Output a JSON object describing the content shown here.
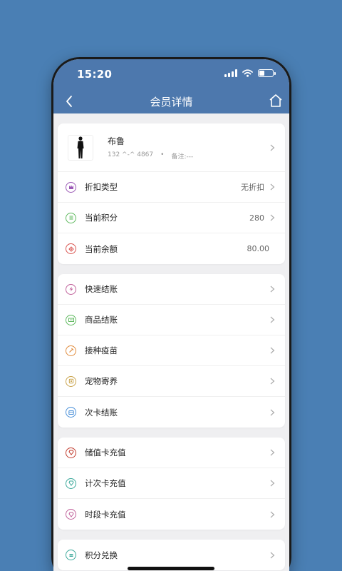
{
  "status": {
    "time": "15:20"
  },
  "nav": {
    "title": "会员详情"
  },
  "profile": {
    "name": "布鲁",
    "phone": "132 ^-^ 4867",
    "dot": "•",
    "note": "备注:---"
  },
  "info_rows": [
    {
      "label": "折扣类型",
      "value": "无折扣",
      "icon": "crown-icon",
      "color": "#9b59b6"
    },
    {
      "label": "当前积分",
      "value": "280",
      "icon": "points-icon",
      "color": "#5cb85c"
    },
    {
      "label": "当前余额",
      "value": "80.00",
      "icon": "balance-icon",
      "color": "#d9534f"
    }
  ],
  "service_rows": [
    {
      "label": "快速结账",
      "icon": "lightning-icon",
      "color": "#c0609a"
    },
    {
      "label": "商品结账",
      "icon": "goods-icon",
      "color": "#5cb85c"
    },
    {
      "label": "接种疫苗",
      "icon": "vaccine-icon",
      "color": "#e08a3a"
    },
    {
      "label": "宠物寄养",
      "icon": "foster-icon",
      "color": "#c9a34b"
    },
    {
      "label": "次卡结账",
      "icon": "card-icon",
      "color": "#4a90d9"
    }
  ],
  "recharge_rows": [
    {
      "label": "储值卡充值",
      "icon": "stored-card-icon",
      "color": "#c0392b"
    },
    {
      "label": "计次卡充值",
      "icon": "count-card-icon",
      "color": "#3aa89a"
    },
    {
      "label": "时段卡充值",
      "icon": "period-card-icon",
      "color": "#c0609a"
    }
  ],
  "exchange_rows": [
    {
      "label": "积分兑换",
      "icon": "exchange-icon",
      "color": "#3aa89a"
    }
  ]
}
